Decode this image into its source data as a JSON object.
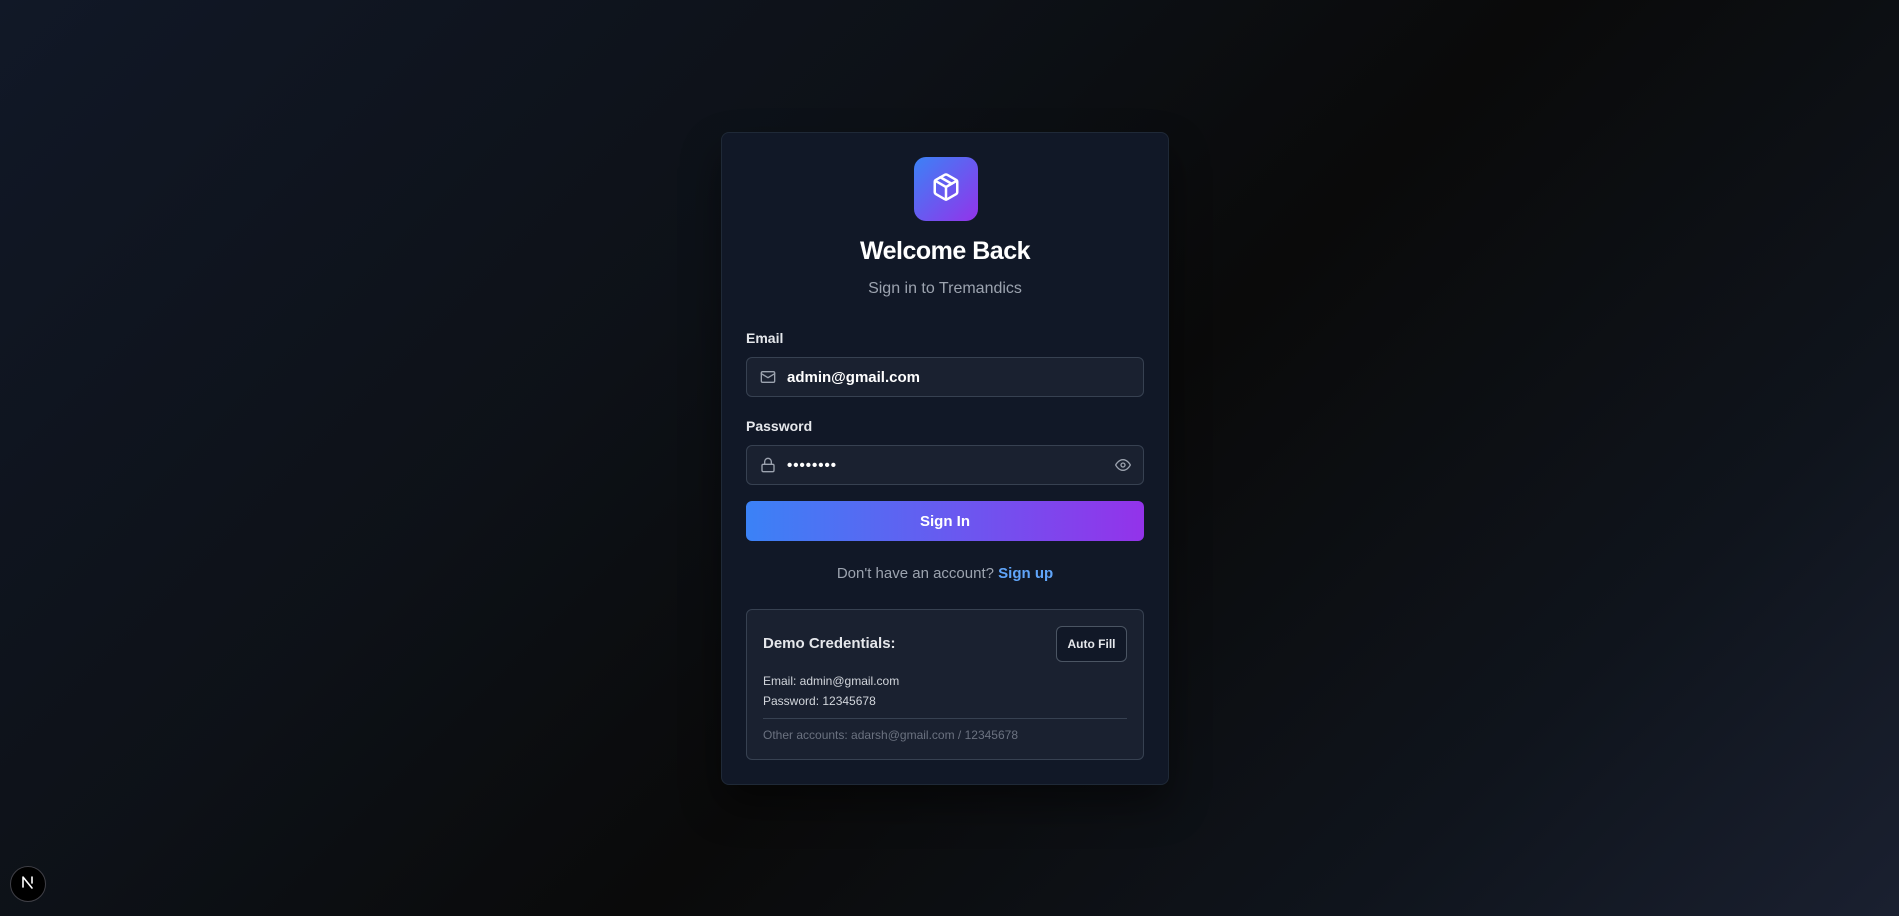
{
  "card": {
    "title": "Welcome Back",
    "subtitle": "Sign in to Tremandics"
  },
  "logo": {
    "icon": "package-icon"
  },
  "form": {
    "email_label": "Email",
    "email_value": "admin@gmail.com",
    "email_icon": "mail-icon",
    "password_label": "Password",
    "password_value": "••••••••",
    "password_icon": "lock-icon",
    "toggle_icon": "eye-icon",
    "submit_label": "Sign In"
  },
  "signup": {
    "prompt": "Don't have an account?",
    "link_label": "Sign up"
  },
  "demo": {
    "title": "Demo Credentials:",
    "autofill_label": "Auto Fill",
    "email_line": "Email: admin@gmail.com",
    "password_line": "Password: 12345678",
    "other_line": "Other accounts: adarsh@gmail.com / 12345678"
  },
  "badge": {
    "letter": "N"
  },
  "colors": {
    "accent_start": "#3b82f6",
    "accent_end": "#9333ea",
    "link": "#60a5fa",
    "card_bg": "#111827"
  }
}
